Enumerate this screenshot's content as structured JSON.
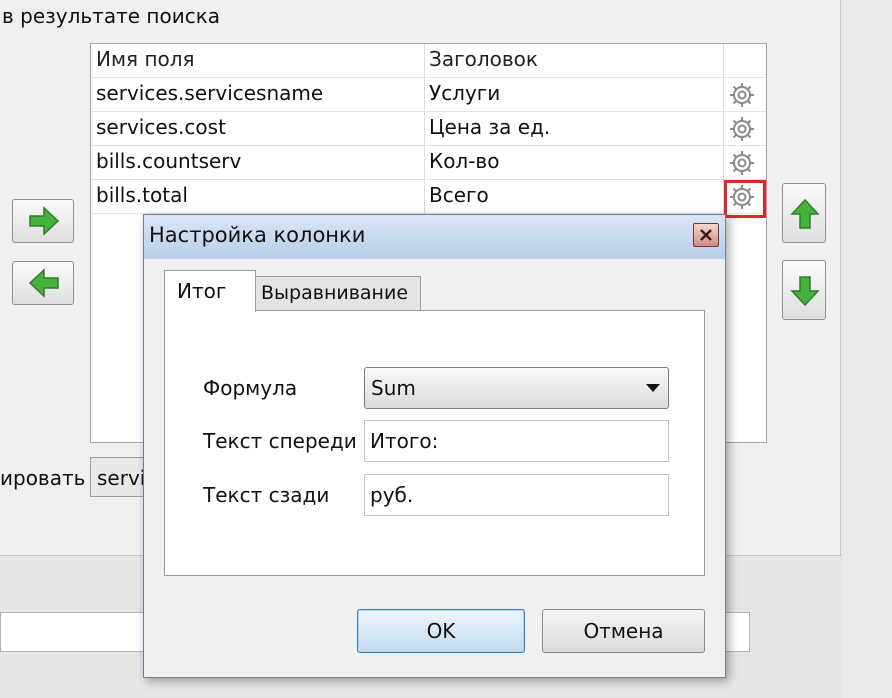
{
  "background": {
    "heading": "в результате поиска",
    "side_label": "ировать",
    "field_value": "servi"
  },
  "grid": {
    "columns": [
      "Имя поля",
      "Заголовок"
    ],
    "rows": [
      {
        "field": "services.servicesname",
        "title": "Услуги"
      },
      {
        "field": "services.cost",
        "title": "Цена за ед."
      },
      {
        "field": "bills.countserv",
        "title": "Кол-во"
      },
      {
        "field": "bills.total",
        "title": "Всего"
      }
    ]
  },
  "dialog": {
    "title": "Настройка колонки",
    "tabs": [
      "Итог",
      "Выравнивание"
    ],
    "formula_label": "Формула",
    "formula_value": "Sum",
    "prefix_label": "Текст спереди",
    "prefix_value": "Итого:",
    "suffix_label": "Текст сзади",
    "suffix_value": "руб.",
    "ok_label": "OK",
    "cancel_label": "Отмена"
  },
  "colors": {
    "highlight": "#d92a2a",
    "arrow_green": "#3aa23a",
    "titlebar": "#c3d5ec"
  }
}
